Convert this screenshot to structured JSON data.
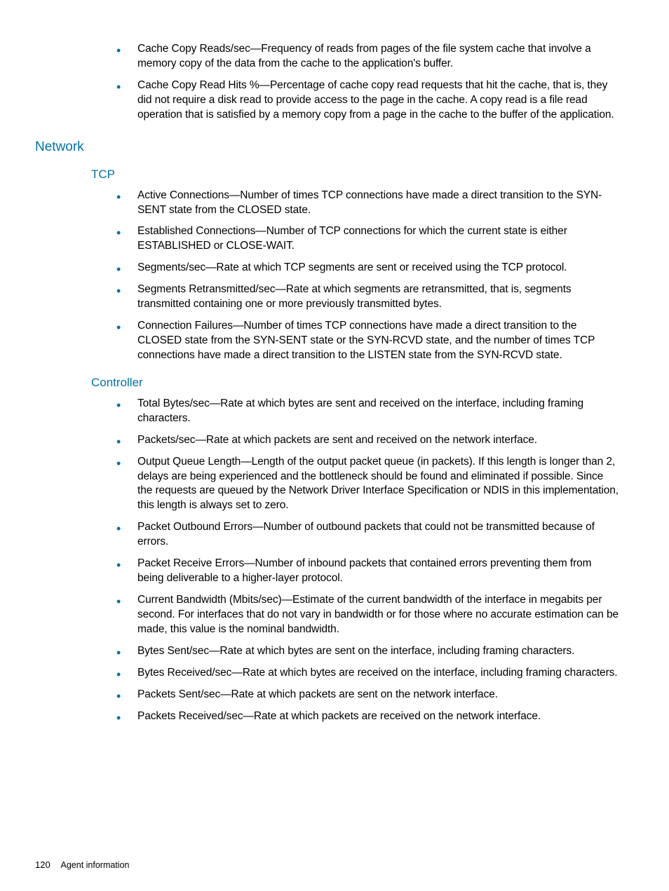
{
  "topList": [
    "Cache Copy Reads/sec—Frequency of reads from pages of the file system cache that involve a memory copy of the data from the cache to the application's buffer.",
    "Cache Copy Read Hits %—Percentage of cache copy read requests that hit the cache, that is, they did not require a disk read to provide access to the page in the cache. A copy read is a file read operation that is satisfied by a memory copy from a page in the cache to the buffer of the application."
  ],
  "heading_network": "Network",
  "heading_tcp": "TCP",
  "tcpList": [
    "Active Connections—Number of times TCP connections have made a direct transition to the SYN-SENT state from the CLOSED state.",
    "Established Connections—Number of TCP connections for which the current state is either ESTABLISHED or CLOSE-WAIT.",
    "Segments/sec—Rate at which TCP segments are sent or received using the TCP protocol.",
    "Segments Retransmitted/sec—Rate at which segments are retransmitted, that is, segments transmitted containing one or more previously transmitted bytes.",
    "Connection Failures—Number of times TCP connections have made a direct transition to the CLOSED state from the SYN-SENT state or the SYN-RCVD state, and the number of times TCP connections have made a direct transition to the LISTEN state from the SYN-RCVD state."
  ],
  "heading_controller": "Controller",
  "controllerList": [
    "Total Bytes/sec—Rate at which bytes are sent and received on the interface, including framing characters.",
    "Packets/sec—Rate at which packets are sent and received on the network interface.",
    "Output Queue Length—Length of the output packet queue (in packets). If this length is longer than 2, delays are being experienced and the bottleneck should be found and eliminated if possible. Since the requests are queued by the Network Driver Interface Specification or NDIS in this implementation, this length is always set to zero.",
    "Packet Outbound Errors—Number of outbound packets that could not be transmitted because of errors.",
    "Packet Receive Errors—Number of inbound packets that contained errors preventing them from being deliverable to a higher-layer protocol.",
    "Current Bandwidth (Mbits/sec)—Estimate of the current bandwidth of the interface in megabits per second. For interfaces that do not vary in bandwidth or for those where no accurate estimation can be made, this value is the nominal bandwidth.",
    "Bytes Sent/sec—Rate at which bytes are sent on the interface, including framing characters.",
    "Bytes Received/sec—Rate at which bytes are received on the interface, including framing characters.",
    "Packets Sent/sec—Rate at which packets are sent on the network interface.",
    "Packets Received/sec—Rate at which packets are received on the network interface."
  ],
  "footer": {
    "page": "120",
    "section": "Agent information"
  }
}
